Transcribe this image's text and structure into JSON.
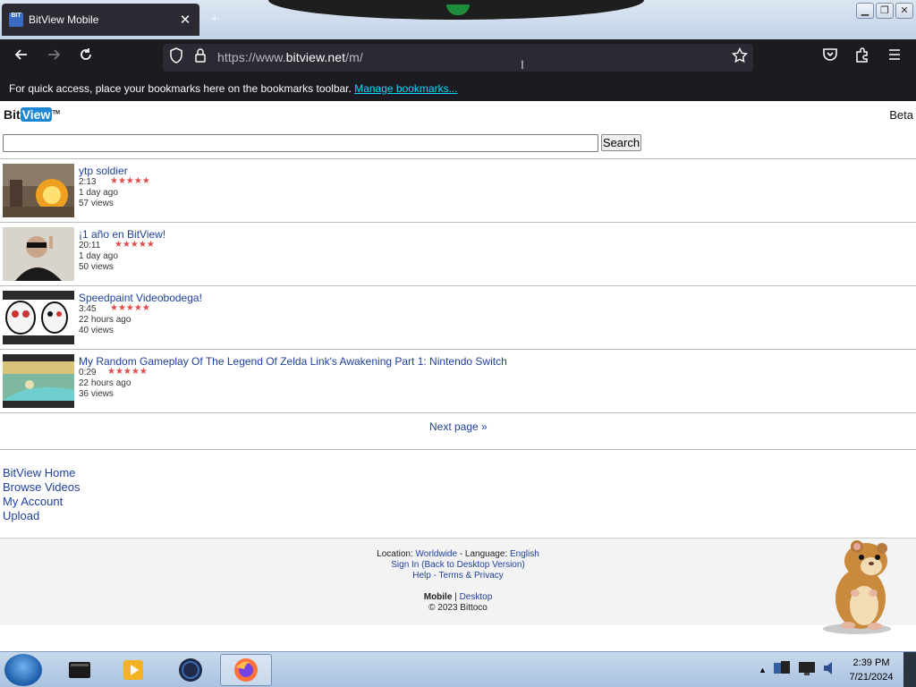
{
  "browser": {
    "tab_title": "BitView Mobile",
    "tab_favicon_text": "BIT",
    "tab_close": "✕",
    "new_tab": "+",
    "url_prefix": "https://www.",
    "url_domain": "bitview.net",
    "url_path": "/m/",
    "bookmarks_msg": "For quick access, place your bookmarks here on the bookmarks toolbar.",
    "manage_bookmarks": "Manage bookmarks..."
  },
  "site": {
    "logo_bit": "Bit",
    "logo_view": "View",
    "logo_tm": "TM",
    "beta": "Beta",
    "search_label": "Search",
    "search_value": ""
  },
  "videos": [
    {
      "title": "ytp soldier",
      "duration": "2:13",
      "age": "1 day ago",
      "views": "57 views",
      "stars": "★★★★★"
    },
    {
      "title": "¡1 año en BitView!",
      "duration": "20:11",
      "age": "1 day ago",
      "views": "50 views",
      "stars": "★★★★★"
    },
    {
      "title": "Speedpaint Videobodega!",
      "duration": "3:45",
      "age": "22 hours ago",
      "views": "40 views",
      "stars": "★★★★★"
    },
    {
      "title": "My Random Gameplay Of The Legend Of Zelda Link's Awakening Part 1: Nintendo Switch",
      "duration": "0:29",
      "age": "22 hours ago",
      "views": "36 views",
      "stars": "★★★★★"
    }
  ],
  "next_page": "Next page »",
  "links": [
    "BitView Home",
    "Browse Videos",
    "My Account",
    "Upload"
  ],
  "footer": {
    "location_label": "Location:",
    "location_value": "Worldwide",
    "language_label": "- Language:",
    "language_value": "English",
    "sign_in": "Sign In",
    "back_desktop": "(Back to Desktop Version)",
    "help": "Help",
    "sep": "-",
    "terms": "Terms & Privacy",
    "mobile": "Mobile",
    "pipe": "|",
    "desktop": "Desktop",
    "copyright": "© 2023 Bittoco"
  },
  "taskbar": {
    "time": "2:39 PM",
    "date": "7/21/2024"
  },
  "colors": {
    "link": "#1e3f9e",
    "star": "#e04c4c",
    "chrome_dark": "#1c1b22"
  }
}
